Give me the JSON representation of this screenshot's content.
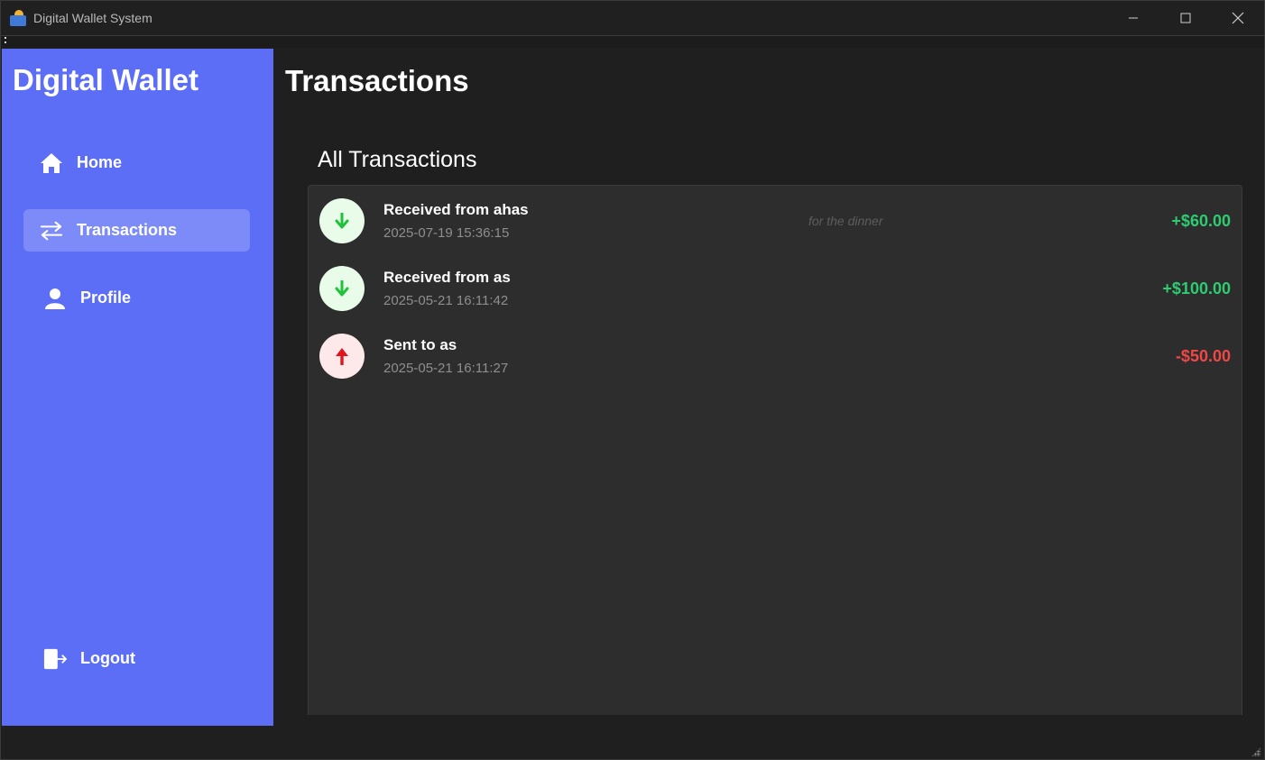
{
  "window": {
    "title": "Digital Wallet System"
  },
  "sidebar": {
    "brand": "Digital Wallet",
    "items": [
      {
        "label": "Home",
        "icon": "home-icon",
        "active": false
      },
      {
        "label": "Transactions",
        "icon": "transfer-icon",
        "active": true
      },
      {
        "label": "Profile",
        "icon": "user-icon",
        "active": false
      }
    ],
    "logout_label": "Logout"
  },
  "main": {
    "page_title": "Transactions",
    "section_title": "All Transactions",
    "transactions": [
      {
        "title": "Received from ahas",
        "timestamp": "2025-07-19 15:36:15",
        "note": "for the dinner",
        "amount": "+$60.00",
        "direction": "in"
      },
      {
        "title": "Received from as",
        "timestamp": "2025-05-21 16:11:42",
        "note": "",
        "amount": "+$100.00",
        "direction": "in"
      },
      {
        "title": "Sent to as",
        "timestamp": "2025-05-21 16:11:27",
        "note": "",
        "amount": "-$50.00",
        "direction": "out"
      }
    ]
  },
  "colors": {
    "sidebar_bg": "#5b6ef5",
    "active_item_bg": "#7c8bf7",
    "incoming_amount": "#2ecc71",
    "outgoing_amount": "#f04747",
    "incoming_arrow": "#1fc23a",
    "outgoing_arrow": "#e0141d"
  }
}
